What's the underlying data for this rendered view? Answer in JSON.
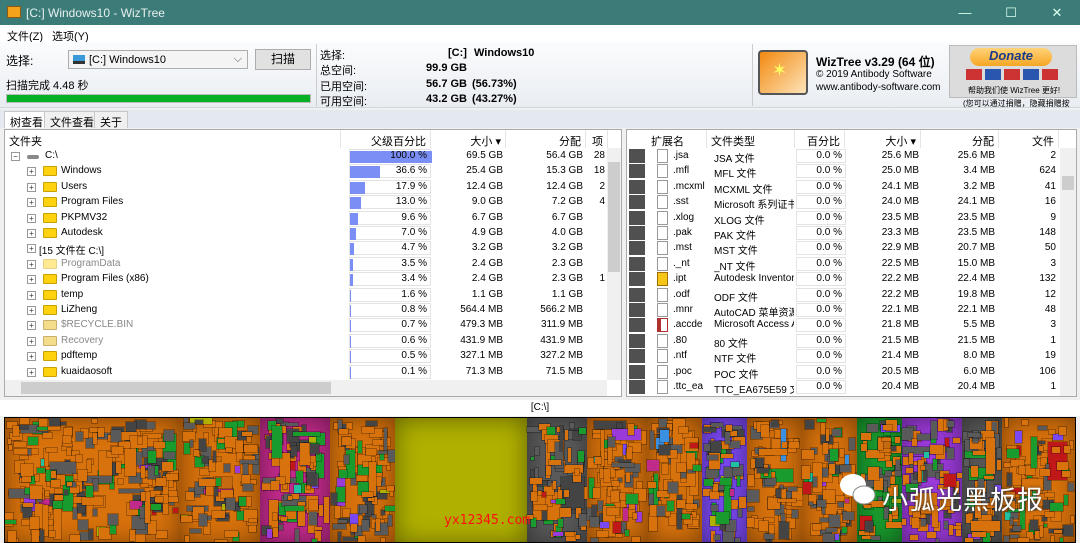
{
  "window": {
    "title": "[C:] Windows10  - WizTree",
    "minimize": "—",
    "maximize": "☐",
    "close": "✕"
  },
  "menu": [
    "文件(Z)",
    "选项(Y)"
  ],
  "scan": {
    "select_label": "选择:",
    "drive": "[C:] Windows10",
    "scan_button": "扫描",
    "status": "扫描完成 4.48 秒",
    "progress_percent": 100
  },
  "drive_info": {
    "select_label": "选择:",
    "drive_letter": "[C:]",
    "drive_name": "Windows10",
    "total_label": "总空间:",
    "total": "99.9 GB",
    "used_label": "已用空间:",
    "used": "56.7 GB",
    "used_pct": "(56.73%)",
    "free_label": "可用空间:",
    "free": "43.2 GB",
    "free_pct": "(43.27%)"
  },
  "about": {
    "product": "WizTree v3.29 (64 位)",
    "copyright": "© 2019 Antibody Software",
    "website": "www.antibody-software.com",
    "donate": "Donate",
    "help_text": "帮助我们使 WizTree 更好!",
    "note": "(您可以通过捐赠，隐藏捐赠按钮)"
  },
  "tabs": [
    "树查看",
    "文件查看",
    "关于"
  ],
  "tree": {
    "headers": [
      "文件夹",
      "父级百分比",
      "大小 ▾",
      "分配",
      "项"
    ],
    "rows": [
      {
        "name": "C:\\",
        "pct": 100.0,
        "pct_label": "100.0 %",
        "size": "69.5 GB",
        "alloc": "56.4 GB",
        "items": "28",
        "type": "drive"
      },
      {
        "name": "Windows",
        "pct": 36.6,
        "pct_label": "36.6 %",
        "size": "25.4 GB",
        "alloc": "15.3 GB",
        "items": "18",
        "type": "folder"
      },
      {
        "name": "Users",
        "pct": 17.9,
        "pct_label": "17.9 %",
        "size": "12.4 GB",
        "alloc": "12.4 GB",
        "items": "2",
        "type": "folder"
      },
      {
        "name": "Program Files",
        "pct": 13.0,
        "pct_label": "13.0 %",
        "size": "9.0 GB",
        "alloc": "7.2 GB",
        "items": "4",
        "type": "folder"
      },
      {
        "name": "PKPMV32",
        "pct": 9.6,
        "pct_label": "9.6 %",
        "size": "6.7 GB",
        "alloc": "6.7 GB",
        "items": "",
        "type": "folder"
      },
      {
        "name": "Autodesk",
        "pct": 7.0,
        "pct_label": "7.0 %",
        "size": "4.9 GB",
        "alloc": "4.0 GB",
        "items": "",
        "type": "folder"
      },
      {
        "name": "[15 文件在 C:\\]",
        "pct": 4.7,
        "pct_label": "4.7 %",
        "size": "3.2 GB",
        "alloc": "3.2 GB",
        "items": "",
        "type": "files"
      },
      {
        "name": "ProgramData",
        "pct": 3.5,
        "pct_label": "3.5 %",
        "size": "2.4 GB",
        "alloc": "2.3 GB",
        "items": "",
        "type": "hidden"
      },
      {
        "name": "Program Files (x86)",
        "pct": 3.4,
        "pct_label": "3.4 %",
        "size": "2.4 GB",
        "alloc": "2.3 GB",
        "items": "1",
        "type": "folder"
      },
      {
        "name": "temp",
        "pct": 1.6,
        "pct_label": "1.6 %",
        "size": "1.1 GB",
        "alloc": "1.1 GB",
        "items": "",
        "type": "folder"
      },
      {
        "name": "LiZheng",
        "pct": 0.8,
        "pct_label": "0.8 %",
        "size": "564.4 MB",
        "alloc": "566.2 MB",
        "items": "",
        "type": "folder"
      },
      {
        "name": "$RECYCLE.BIN",
        "pct": 0.7,
        "pct_label": "0.7 %",
        "size": "479.3 MB",
        "alloc": "311.9 MB",
        "items": "",
        "type": "system"
      },
      {
        "name": "Recovery",
        "pct": 0.6,
        "pct_label": "0.6 %",
        "size": "431.9 MB",
        "alloc": "431.9 MB",
        "items": "",
        "type": "system"
      },
      {
        "name": "pdftemp",
        "pct": 0.5,
        "pct_label": "0.5 %",
        "size": "327.1 MB",
        "alloc": "327.2 MB",
        "items": "",
        "type": "folder"
      },
      {
        "name": "kuaidaosoft",
        "pct": 0.1,
        "pct_label": "0.1 %",
        "size": "71.3 MB",
        "alloc": "71.5 MB",
        "items": "",
        "type": "folder"
      }
    ]
  },
  "files": {
    "headers": [
      "扩展名",
      "文件类型",
      "百分比",
      "大小 ▾",
      "分配",
      "文件"
    ],
    "rows": [
      {
        "ext": ".jsa",
        "type": "JSA 文件",
        "pct": "0.0 %",
        "size": "25.6 MB",
        "alloc": "25.6 MB",
        "count": "2"
      },
      {
        "ext": ".mfl",
        "type": "MFL 文件",
        "pct": "0.0 %",
        "size": "25.0 MB",
        "alloc": "3.4 MB",
        "count": "624"
      },
      {
        "ext": ".mcxml",
        "type": "MCXML 文件",
        "pct": "0.0 %",
        "size": "24.1 MB",
        "alloc": "3.2 MB",
        "count": "41"
      },
      {
        "ext": ".sst",
        "type": "Microsoft 系列证书",
        "pct": "0.0 %",
        "size": "24.0 MB",
        "alloc": "24.1 MB",
        "count": "16"
      },
      {
        "ext": ".xlog",
        "type": "XLOG 文件",
        "pct": "0.0 %",
        "size": "23.5 MB",
        "alloc": "23.5 MB",
        "count": "9"
      },
      {
        "ext": ".pak",
        "type": "PAK 文件",
        "pct": "0.0 %",
        "size": "23.3 MB",
        "alloc": "23.5 MB",
        "count": "148"
      },
      {
        "ext": ".mst",
        "type": "MST 文件",
        "pct": "0.0 %",
        "size": "22.9 MB",
        "alloc": "20.7 MB",
        "count": "50"
      },
      {
        "ext": "._nt",
        "type": "_NT 文件",
        "pct": "0.0 %",
        "size": "22.5 MB",
        "alloc": "15.0 MB",
        "count": "3"
      },
      {
        "ext": ".ipt",
        "type": "Autodesk Inventor",
        "pct": "0.0 %",
        "size": "22.2 MB",
        "alloc": "22.4 MB",
        "count": "132"
      },
      {
        "ext": ".odf",
        "type": "ODF 文件",
        "pct": "0.0 %",
        "size": "22.2 MB",
        "alloc": "19.8 MB",
        "count": "12"
      },
      {
        "ext": ".mnr",
        "type": "AutoCAD 菜单资源",
        "pct": "0.0 %",
        "size": "22.1 MB",
        "alloc": "22.1 MB",
        "count": "48"
      },
      {
        "ext": ".accde",
        "type": "Microsoft Access A",
        "pct": "0.0 %",
        "size": "21.8 MB",
        "alloc": "5.5 MB",
        "count": "3"
      },
      {
        "ext": ".80",
        "type": "80 文件",
        "pct": "0.0 %",
        "size": "21.5 MB",
        "alloc": "21.5 MB",
        "count": "1"
      },
      {
        "ext": ".ntf",
        "type": "NTF 文件",
        "pct": "0.0 %",
        "size": "21.4 MB",
        "alloc": "8.0 MB",
        "count": "19"
      },
      {
        "ext": ".poc",
        "type": "POC 文件",
        "pct": "0.0 %",
        "size": "20.5 MB",
        "alloc": "6.0 MB",
        "count": "106"
      },
      {
        "ext": ".ttc_ea",
        "type": "TTC_EA675E59 文",
        "pct": "0.0 %",
        "size": "20.4 MB",
        "alloc": "20.4 MB",
        "count": "1"
      }
    ]
  },
  "treemap": {
    "path": "[C:\\]",
    "palette": [
      "#d8720c",
      "#c56a10",
      "#5a5a5a",
      "#444444",
      "#1a9b2e",
      "#3a8fe0",
      "#b0b000",
      "#c02a8a",
      "#7a48f0",
      "#20c0a0",
      "#9a3ad8",
      "#c01818"
    ]
  },
  "watermarks": {
    "wechat": "小弧光黑板报",
    "site": "yx12345.com"
  }
}
